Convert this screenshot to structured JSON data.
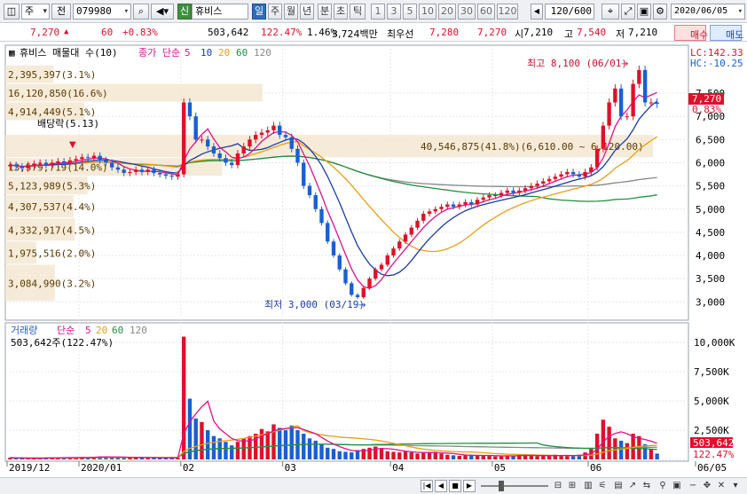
{
  "toolbar": {
    "market_sel": "주",
    "prefix": "전",
    "code": "079980",
    "stock_badge": "신",
    "stock_name": "휴비스",
    "periods": [
      "일",
      "주",
      "월",
      "년",
      "분",
      "초",
      "틱"
    ],
    "active_period": "일",
    "intervals": [
      "1",
      "3",
      "5",
      "10",
      "20",
      "30",
      "60",
      "120"
    ],
    "count": "120",
    "count_total": "/600",
    "date": "2020/06/05"
  },
  "info": {
    "price": "7,270",
    "arrow": "▲",
    "change": "60",
    "change_pct": "+0.83%",
    "volume": "503,642",
    "volume_ratio": "122.47%",
    "turnover": "1.46%",
    "amount": "3,724백만",
    "priority_label": "최우선",
    "ask": "7,280",
    "bid": "7,270",
    "open_label": "시",
    "open": "7,210",
    "high_label": "고",
    "high": "7,540",
    "low_label": "저",
    "low": "7,210",
    "buy_label": "매수",
    "sell_label": "매도"
  },
  "price_panel": {
    "title": "휴비스 매물대 수(10)",
    "indicator": "종가 단순",
    "ma_periods": [
      {
        "label": "5",
        "color": "#e0108a"
      },
      {
        "label": "10",
        "color": "#1a3ca8"
      },
      {
        "label": "20",
        "color": "#e8a010"
      },
      {
        "label": "60",
        "color": "#1f8f3f"
      },
      {
        "label": "120",
        "color": "#888888"
      }
    ],
    "lc": "LC:142.33",
    "hc": "HC:-10.25",
    "high_note": "최고 8,100 (06/01)",
    "low_note": "최저 3,000 (03/19)",
    "dividend_note": "배당락(5.13)",
    "volume_profile": [
      {
        "label": "2,395,397(3.1%)",
        "low": 7700,
        "high": 8100,
        "pct": 3.1
      },
      {
        "label": "16,120,850(16.6%)",
        "low": 7300,
        "high": 7700,
        "pct": 16.6
      },
      {
        "label": "4,914,449(5.1%)",
        "low": 6900,
        "high": 7300,
        "pct": 5.1
      },
      {
        "label": "40,546,875(41.8%)(6,610.00 ~ 6,120.00)",
        "low": 6100,
        "high": 6600,
        "pct": 41.8
      },
      {
        "label": "13,579,719(14.0%)",
        "low": 5700,
        "high": 6100,
        "pct": 14.0
      },
      {
        "label": "5,123,989(5.3%)",
        "low": 5300,
        "high": 5700,
        "pct": 5.3
      },
      {
        "label": "4,307,537(4.4%)",
        "low": 4800,
        "high": 5300,
        "pct": 4.4
      },
      {
        "label": "4,332,917(4.5%)",
        "low": 4300,
        "high": 4800,
        "pct": 4.5
      },
      {
        "label": "1,975,516(2.0%)",
        "low": 3800,
        "high": 4300,
        "pct": 2.0
      },
      {
        "label": "3,084,990(3.2%)",
        "low": 3000,
        "high": 3800,
        "pct": 3.2
      }
    ],
    "current_price": "7,270",
    "current_pct": "0.83%"
  },
  "volume_panel": {
    "title": "거래량",
    "indicator": "단순",
    "ma_periods": [
      {
        "label": "5",
        "color": "#e0108a"
      },
      {
        "label": "20",
        "color": "#e8a010"
      },
      {
        "label": "60",
        "color": "#1f8f3f"
      },
      {
        "label": "120",
        "color": "#888888"
      }
    ],
    "readout": "503,642주(122.47%)",
    "current_volume": "503,642",
    "current_ratio": "122.47%"
  },
  "colors": {
    "up": "#e0102a",
    "down": "#1a5fd0",
    "ma5": "#e0108a",
    "ma10": "#1a3ca8",
    "ma20": "#e8a010",
    "ma60": "#1f8f3f",
    "ma120": "#888888",
    "profile": "#f4e6cf",
    "profile_text": "#5a3a00"
  },
  "chart_data": {
    "type": "candlestick",
    "y_axis": {
      "ticks": [
        3000,
        3500,
        4000,
        4500,
        5000,
        5500,
        6000,
        6500,
        7000,
        7500
      ],
      "labels": [
        "3,000",
        "3,500",
        "4,000",
        "4,500",
        "5,000",
        "5,500",
        "6,000",
        "6,500",
        "7,000",
        "7,500"
      ],
      "range": [
        2700,
        8400
      ]
    },
    "volume_axis": {
      "ticks": [
        0,
        2500,
        5000,
        7500,
        10000
      ],
      "labels": [
        "",
        "2,500K",
        "5,000K",
        "7,500K",
        "10,000K"
      ],
      "range": [
        0,
        11000
      ]
    },
    "x_axis": {
      "labels": [
        "2019/12",
        "2020/01",
        "02",
        "03",
        "04",
        "05",
        "06",
        "06/05"
      ],
      "positions": [
        0,
        12,
        29,
        46,
        64,
        81,
        97,
        117
      ]
    },
    "trading_days": 109,
    "close": [
      5950,
      5920,
      5880,
      5950,
      5980,
      6000,
      5950,
      6000,
      6030,
      6000,
      6050,
      6080,
      6120,
      6100,
      6150,
      6050,
      6000,
      5900,
      5850,
      5780,
      5800,
      5850,
      5800,
      5850,
      5780,
      5750,
      5720,
      5700,
      5750,
      7300,
      7000,
      6500,
      6500,
      6350,
      6200,
      6100,
      6000,
      5950,
      6200,
      6350,
      6500,
      6600,
      6650,
      6700,
      6800,
      6600,
      6550,
      6300,
      6000,
      5500,
      5300,
      5000,
      4700,
      4300,
      4000,
      3700,
      3400,
      3150,
      3100,
      3300,
      3500,
      3700,
      3800,
      4000,
      4150,
      4300,
      4450,
      4600,
      4750,
      4900,
      4950,
      5000,
      5050,
      5100,
      5050,
      5100,
      5150,
      5100,
      5200,
      5250,
      5300,
      5300,
      5350,
      5400,
      5350,
      5400,
      5450,
      5500,
      5550,
      5600,
      5650,
      5700,
      5750,
      5800,
      5750,
      5700,
      5800,
      5900,
      6300,
      6800,
      7300,
      7600,
      7000,
      7000,
      7700,
      8000,
      7300,
      7300,
      7270
    ],
    "volume": [
      150,
      120,
      100,
      90,
      110,
      130,
      150,
      160,
      180,
      150,
      140,
      160,
      200,
      180,
      220,
      250,
      200,
      180,
      160,
      200,
      180,
      150,
      140,
      130,
      150,
      160,
      140,
      120,
      130,
      10500,
      5200,
      3500,
      3200,
      2500,
      2000,
      1800,
      1500,
      1200,
      1500,
      1800,
      2000,
      2200,
      2600,
      2400,
      3000,
      2700,
      2500,
      2900,
      2500,
      2200,
      1800,
      1600,
      1300,
      1000,
      900,
      700,
      650,
      600,
      800,
      900,
      1000,
      1100,
      900,
      700,
      650,
      600,
      700,
      600,
      500,
      550,
      600,
      650,
      500,
      400,
      350,
      300,
      350,
      400,
      350,
      300,
      300,
      250,
      300,
      350,
      300,
      400,
      350,
      300,
      280,
      300,
      350,
      400,
      350,
      300,
      280,
      400,
      600,
      900,
      2200,
      3400,
      2800,
      1800,
      1600,
      1400,
      2200,
      2000,
      1300,
      900,
      504
    ]
  }
}
